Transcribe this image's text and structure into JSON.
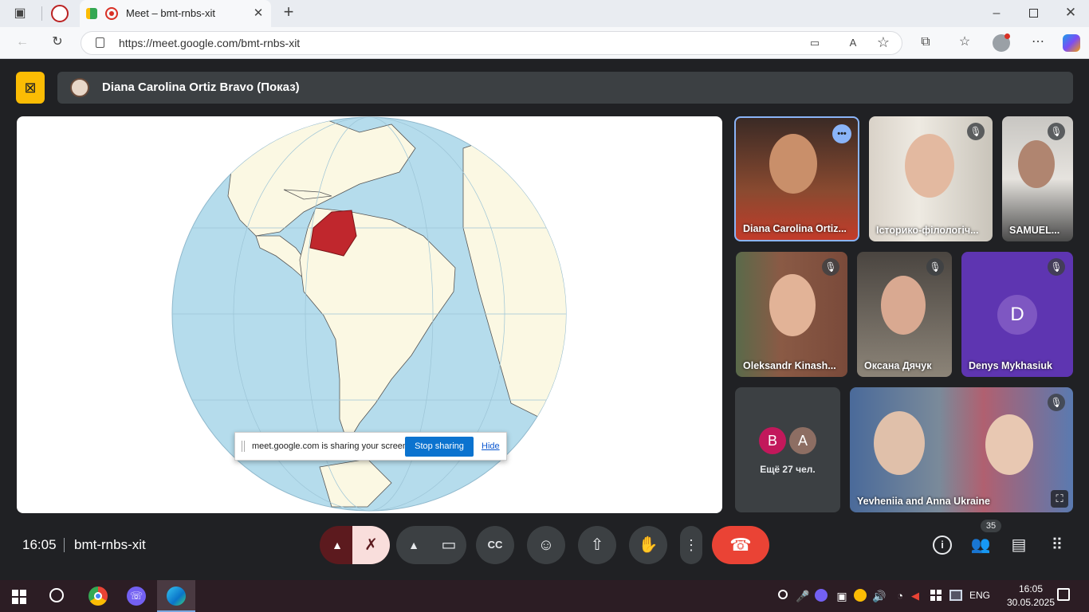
{
  "browser": {
    "tab_title": "Meet – bmt-rnbs-xit",
    "url": "https://meet.google.com/bmt-rnbs-xit",
    "new_tab_icon": "plus-icon"
  },
  "meeting": {
    "presenter_label": "Diana Carolina Ortiz Bravo (Показ)",
    "time": "16:05",
    "code": "bmt-rnbs-xit",
    "participant_count": "35",
    "more_label": "Ещё 27 чел.",
    "more_avatars": [
      {
        "letter": "B",
        "color": "#c2185b"
      },
      {
        "letter": "A",
        "color": "#8d6e63"
      }
    ]
  },
  "participants": [
    {
      "name": "Diana Carolina Ortiz...",
      "muted": false,
      "speaking": true
    },
    {
      "name": "Історико-філологіч...",
      "muted": true
    },
    {
      "name": "SAMUEL...",
      "muted": true
    },
    {
      "name": "Oleksandr Kinash...",
      "muted": true
    },
    {
      "name": "Оксана Дячук",
      "muted": true
    },
    {
      "name": "Denys Mykhasiuk",
      "initial": "D",
      "muted": true
    },
    {
      "name": "Yevheniia and Anna Ukraine",
      "muted": true
    }
  ],
  "share_notice": {
    "text": "meet.google.com is sharing your screen.",
    "stop_label": "Stop sharing",
    "hide_label": "Hide"
  },
  "system": {
    "lang": "ENG",
    "time": "16:05",
    "date": "30.05.2025"
  },
  "colors": {
    "accent": "#1a73e8",
    "end_call": "#ea4335",
    "colombia": "#c0272d",
    "ocean": "#b5dcec",
    "land": "#fbf8e3",
    "presenting_badge": "#fbbc04"
  }
}
